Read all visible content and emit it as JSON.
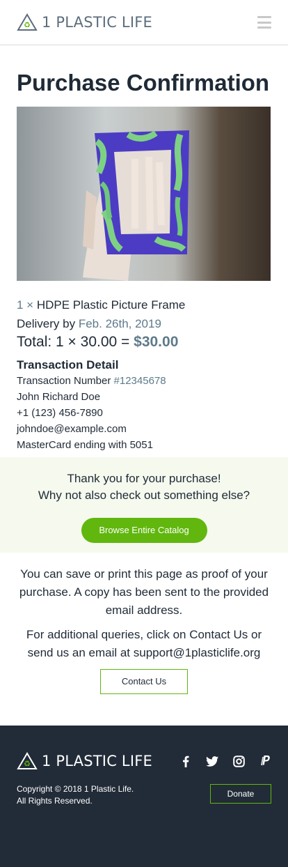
{
  "header": {
    "brand": "1 PLASTIC LIFE",
    "logo_icon": "recycle-triangle-icon",
    "menu_icon": "hamburger-menu-icon"
  },
  "page": {
    "title": "Purchase Confirmation"
  },
  "product": {
    "image_icon": "picture-frame-photo"
  },
  "order": {
    "quantity": "1 ×",
    "item_name": "HDPE Plastic Picture Frame",
    "delivery_label": "Delivery by",
    "delivery_date": "Feb. 26th, 2019",
    "total_label": "Total: 1 × 30.00 =",
    "total_value": "$30.00"
  },
  "transaction": {
    "title": "Transaction Detail",
    "number_label": "Transaction Number",
    "number_value": "#12345678",
    "name": "John Richard Doe",
    "phone": "+1 (123) 456-7890",
    "email": "johndoe@example.com",
    "payment": "MasterCard ending with 5051"
  },
  "thanks": {
    "line1": "Thank you for your purchase!",
    "line2": "Why not also check out something else?",
    "browse_label": "Browse Entire Catalog"
  },
  "info": {
    "save_text": "You can save or print this page as proof of your purchase. A copy has been sent to the provided email address.",
    "queries_text": "For additional queries, click on Contact Us or send us an email at support@1plasticlife.org",
    "contact_label": "Contact Us"
  },
  "footer": {
    "brand": "1 PLASTIC LIFE",
    "socials": [
      {
        "name": "facebook-icon",
        "glyph": "f"
      },
      {
        "name": "twitter-icon",
        "glyph": "t"
      },
      {
        "name": "instagram-icon",
        "glyph": "i"
      },
      {
        "name": "paypal-icon",
        "glyph": "P"
      }
    ],
    "copyright_line1": "Copyright © 2018 1 Plastic Life.",
    "copyright_line2": "All Rights Reserved.",
    "donate_label": "Donate"
  },
  "colors": {
    "accent_green": "#61b70e",
    "accent_slate": "#5e7a8b",
    "footer_bg": "#222c38",
    "thanks_bg": "#f5f9ee"
  }
}
